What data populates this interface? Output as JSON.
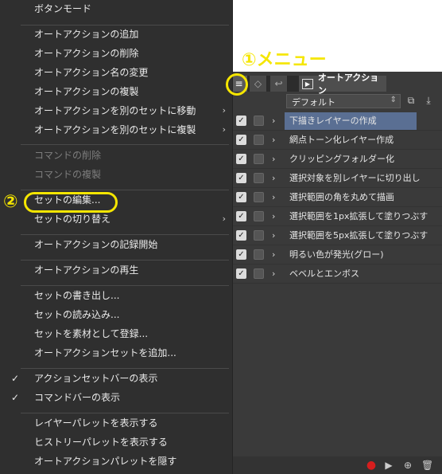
{
  "menu": {
    "items": [
      {
        "label": "ボタンモード",
        "disabled": false
      },
      {
        "label": "オートアクションの追加",
        "disabled": false
      },
      {
        "label": "オートアクションの削除",
        "disabled": false
      },
      {
        "label": "オートアクション名の変更",
        "disabled": false
      },
      {
        "label": "オートアクションの複製",
        "disabled": false
      },
      {
        "label": "オートアクションを別のセットに移動",
        "disabled": false,
        "submenu": true
      },
      {
        "label": "オートアクションを別のセットに複製",
        "disabled": false,
        "submenu": true
      },
      {
        "label": "コマンドの削除",
        "disabled": true
      },
      {
        "label": "コマンドの複製",
        "disabled": true
      },
      {
        "label": "セットの編集...",
        "disabled": false
      },
      {
        "label": "セットの切り替え",
        "disabled": false,
        "submenu": true
      },
      {
        "label": "オートアクションの記録開始",
        "disabled": false
      },
      {
        "label": "オートアクションの再生",
        "disabled": false
      },
      {
        "label": "セットの書き出し...",
        "disabled": false
      },
      {
        "label": "セットの読み込み...",
        "disabled": false
      },
      {
        "label": "セットを素材として登録...",
        "disabled": false
      },
      {
        "label": "オートアクションセットを追加...",
        "disabled": false
      },
      {
        "label": "アクションセットバーの表示",
        "disabled": false,
        "checked": true
      },
      {
        "label": "コマンドバーの表示",
        "disabled": false,
        "checked": true
      },
      {
        "label": "レイヤーパレットを表示する",
        "disabled": false
      },
      {
        "label": "ヒストリーパレットを表示する",
        "disabled": false
      },
      {
        "label": "オートアクションパレットを隠す",
        "disabled": false
      }
    ],
    "submenu_glyph": "›",
    "check_glyph": "✓"
  },
  "palette": {
    "tab_title": "オートアクション",
    "menu_icon": "hamburger-icon",
    "menu_glyph": "≡",
    "set_name": "デフォルト",
    "actions": [
      {
        "name": "下描きレイヤーの作成",
        "enabled": true,
        "selected": true
      },
      {
        "name": "網点トーン化レイヤー作成",
        "enabled": true,
        "selected": false
      },
      {
        "name": "クリッピングフォルダー化",
        "enabled": true,
        "selected": false
      },
      {
        "name": "選択対象を別レイヤーに切り出し",
        "enabled": true,
        "selected": false
      },
      {
        "name": "選択範囲の角を丸めて描画",
        "enabled": true,
        "selected": false
      },
      {
        "name": "選択範囲を1px拡張して塗りつぶす",
        "enabled": true,
        "selected": false
      },
      {
        "name": "選択範囲を5px拡張して塗りつぶす",
        "enabled": true,
        "selected": false
      },
      {
        "name": "明るい色が発光(グロー)",
        "enabled": true,
        "selected": false
      },
      {
        "name": "ベベルとエンボス",
        "enabled": true,
        "selected": false
      }
    ]
  },
  "annotations": {
    "step1": "①メニュー",
    "step2": "②",
    "highlight_color": "#f5e600"
  },
  "colors": {
    "menu_bg": "#2f2f2f",
    "palette_bg": "#3a3a3a",
    "selected_row": "#5a6f93",
    "record": "#d61e1e"
  }
}
